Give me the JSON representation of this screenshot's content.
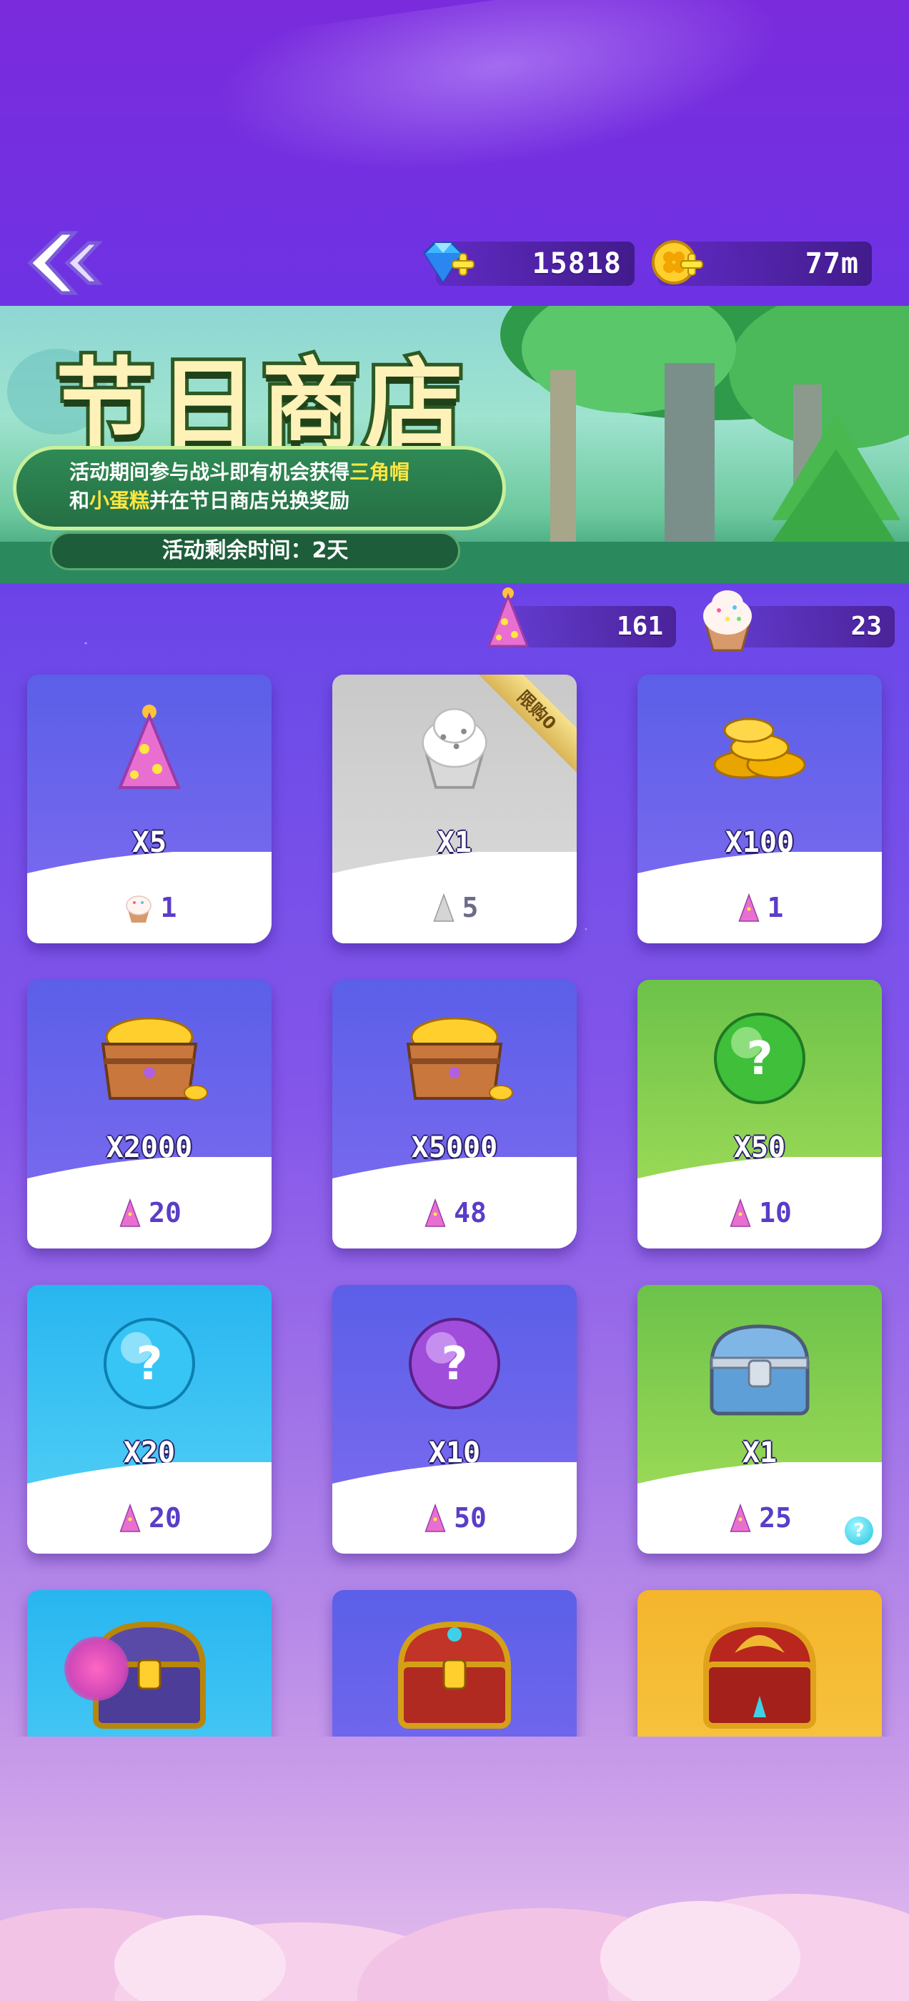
{
  "colors": {
    "accent_yellow": "#ffe641",
    "price_text": "#5a3dc8",
    "card_blue": "#5b5fe8",
    "card_green": "#8ed34a",
    "card_sky": "#39c3f2",
    "card_gold": "#f4b52c",
    "card_disabled": "#cfcfcf"
  },
  "header": {
    "back_icon": "double-chevron-left-icon",
    "gems": {
      "icon": "diamond-icon",
      "value": "15818"
    },
    "coins": {
      "icon": "clover-coin-icon",
      "value": "77m"
    }
  },
  "banner": {
    "title": "节日商店",
    "desc_line1_pre": "活动期间参与战斗即有机会获得",
    "desc_line1_hl": "三角帽",
    "desc_line2_pre": "和",
    "desc_line2_hl": "小蛋糕",
    "desc_line2_post": "并在节日商店兑换奖励",
    "timer": "活动剩余时间：2天"
  },
  "tokens": {
    "party_hat": {
      "icon": "party-hat-icon",
      "value": "161"
    },
    "cupcake": {
      "icon": "cupcake-icon",
      "value": "23"
    }
  },
  "shop": {
    "items": [
      {
        "item": "party-hat",
        "qty": "X5",
        "price": "1",
        "currency": "cupcake",
        "bg": "blue"
      },
      {
        "item": "cupcake-gray",
        "qty": "X1",
        "price": "5",
        "currency": "party-hat-gray",
        "bg": "disabled",
        "ribbon": "限购0"
      },
      {
        "item": "coin-pile",
        "qty": "X100",
        "price": "1",
        "currency": "party-hat",
        "bg": "blue"
      },
      {
        "item": "coin-chest",
        "qty": "X2000",
        "price": "20",
        "currency": "party-hat",
        "bg": "blue"
      },
      {
        "item": "coin-chest",
        "qty": "X5000",
        "price": "48",
        "currency": "party-hat",
        "bg": "blue"
      },
      {
        "item": "green-mystery-orb",
        "qty": "X50",
        "price": "10",
        "currency": "party-hat",
        "bg": "green"
      },
      {
        "item": "blue-mystery-orb",
        "qty": "X20",
        "price": "20",
        "currency": "party-hat",
        "bg": "sky"
      },
      {
        "item": "purple-mystery-orb",
        "qty": "X10",
        "price": "50",
        "currency": "party-hat",
        "bg": "blue"
      },
      {
        "item": "silver-chest",
        "qty": "X1",
        "price": "25",
        "currency": "party-hat",
        "bg": "green",
        "help": "?"
      },
      {
        "item": "purple-gold-chest",
        "qty": "",
        "price": "",
        "currency": "",
        "bg": "sky"
      },
      {
        "item": "red-gold-chest",
        "qty": "",
        "price": "",
        "currency": "",
        "bg": "blue"
      },
      {
        "item": "dragon-chest",
        "qty": "",
        "price": "",
        "currency": "",
        "bg": "gold"
      }
    ]
  }
}
